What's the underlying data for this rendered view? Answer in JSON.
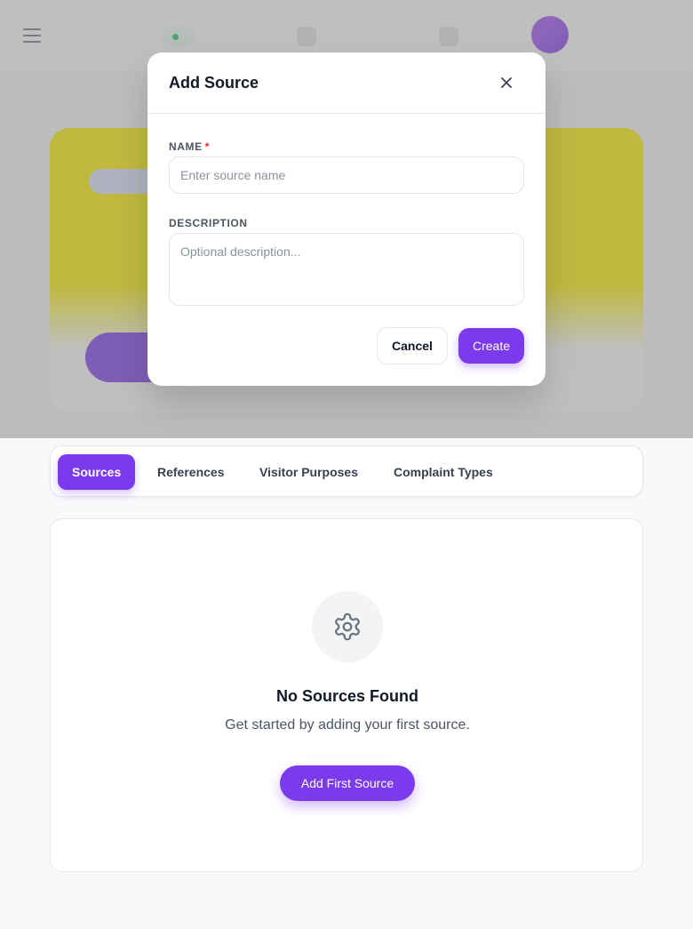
{
  "modal": {
    "title": "Add Source",
    "name_label": "NAME",
    "required_mark": "*",
    "name_placeholder": "Enter source name",
    "name_value": "",
    "description_label": "DESCRIPTION",
    "description_placeholder": "Optional description...",
    "description_value": "",
    "cancel_label": "Cancel",
    "create_label": "Create"
  },
  "tabs": [
    {
      "label": "Sources",
      "active": true
    },
    {
      "label": "References",
      "active": false
    },
    {
      "label": "Visitor Purposes",
      "active": false
    },
    {
      "label": "Complaint Types",
      "active": false
    }
  ],
  "empty_state": {
    "icon": "gear-icon",
    "title": "No Sources Found",
    "subtitle": "Get started by adding your first source.",
    "button_label": "Add First Source"
  },
  "colors": {
    "accent": "#7c3aed",
    "required": "#dc2626",
    "hero_highlight": "#fff200"
  }
}
